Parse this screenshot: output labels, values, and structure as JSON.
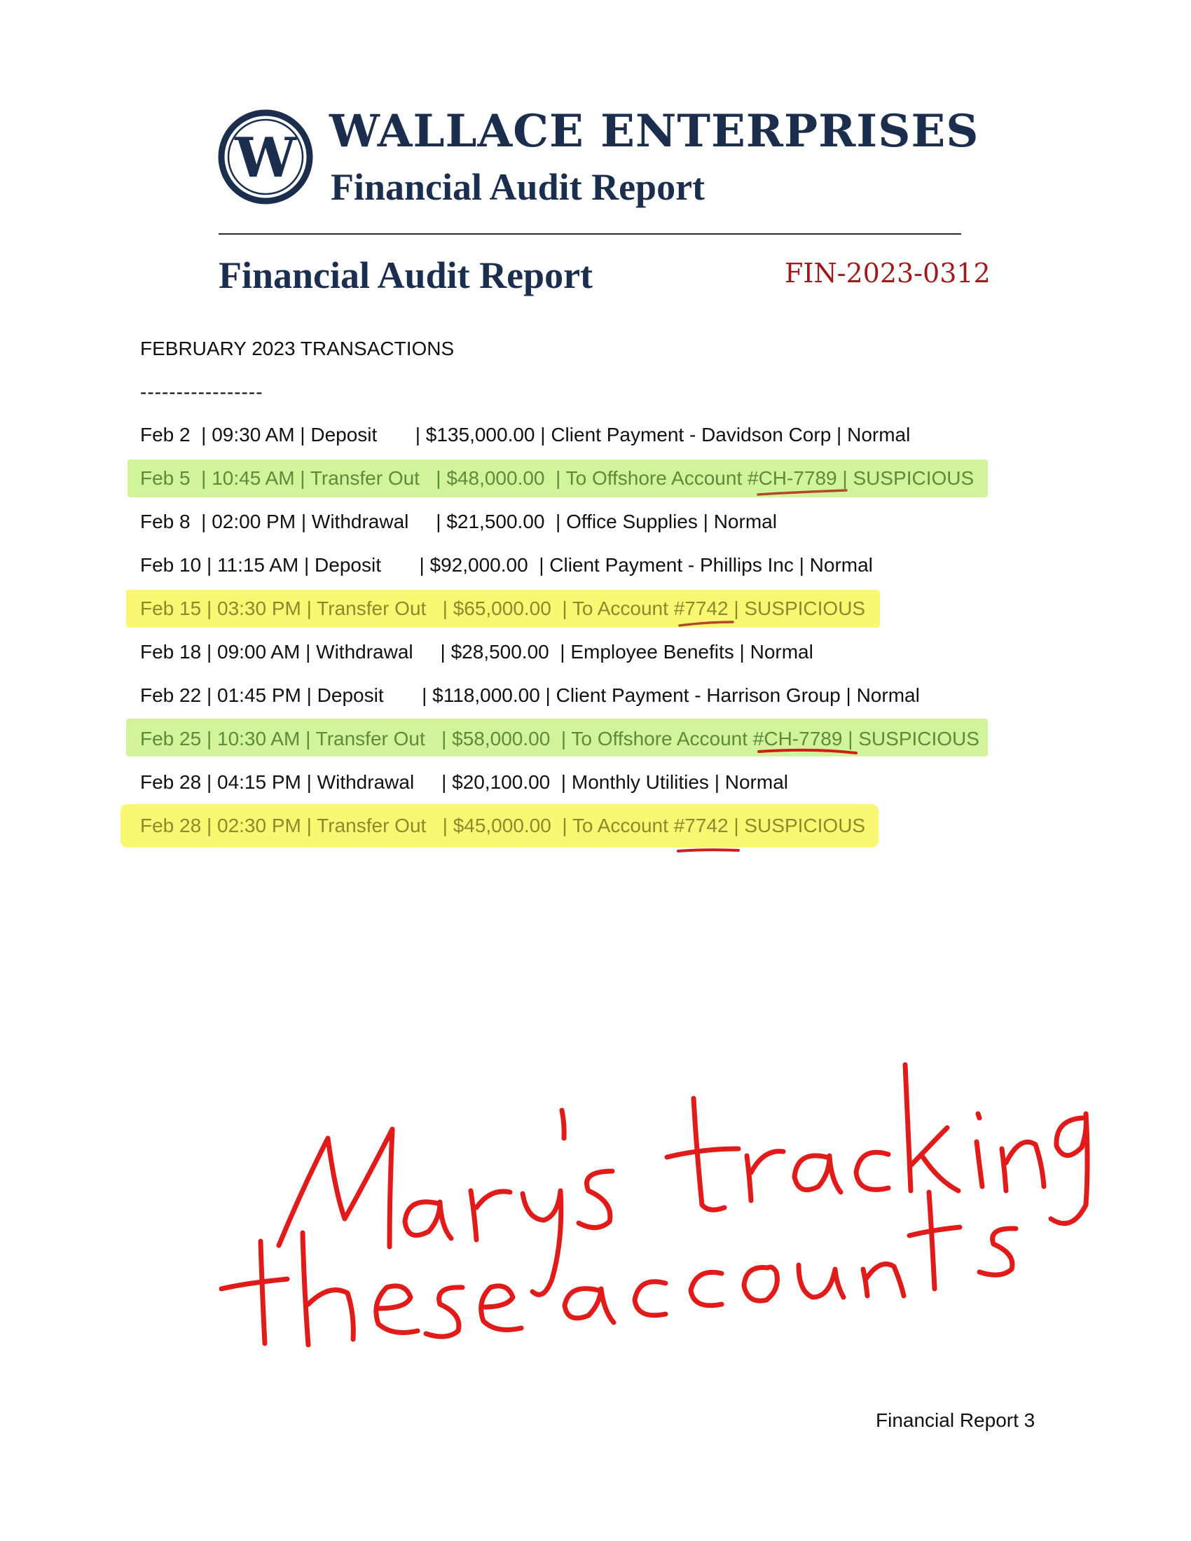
{
  "letterhead": {
    "logo_letter": "W",
    "company_name": "WALLACE ENTERPRISES",
    "subtitle": "Financial Audit Report",
    "brand_color": "#1b2e4e"
  },
  "document": {
    "title": "Financial Audit Report",
    "reference": "FIN-2023-0312",
    "reference_color": "#9e1b1b"
  },
  "section": {
    "heading": "FEBRUARY 2023 TRANSACTIONS",
    "separator": "-----------------"
  },
  "transactions": [
    {
      "text": "Feb 2  | 09:30 AM | Deposit       | $135,000.00 | Client Payment - Davidson Corp | Normal",
      "highlight": "none"
    },
    {
      "text": "Feb 5  | 10:45 AM | Transfer Out   | $48,000.00  | To Offshore Account #CH-7789 | SUSPICIOUS",
      "highlight": "green"
    },
    {
      "text": "Feb 8  | 02:00 PM | Withdrawal     | $21,500.00  | Office Supplies | Normal",
      "highlight": "none"
    },
    {
      "text": "Feb 10 | 11:15 AM | Deposit       | $92,000.00  | Client Payment - Phillips Inc | Normal",
      "highlight": "none"
    },
    {
      "text": "Feb 15 | 03:30 PM | Transfer Out   | $65,000.00  | To Account #7742 | SUSPICIOUS",
      "highlight": "yellow"
    },
    {
      "text": "Feb 18 | 09:00 AM | Withdrawal     | $28,500.00  | Employee Benefits | Normal",
      "highlight": "none"
    },
    {
      "text": "Feb 22 | 01:45 PM | Deposit       | $118,000.00 | Client Payment - Harrison Group | Normal",
      "highlight": "none"
    },
    {
      "text": "Feb 25 | 10:30 AM | Transfer Out   | $58,000.00  | To Offshore Account #CH-7789 | SUSPICIOUS",
      "highlight": "green"
    },
    {
      "text": "Feb 28 | 04:15 PM | Withdrawal     | $20,100.00  | Monthly Utilities | Normal",
      "highlight": "none"
    },
    {
      "text": "Feb 28 | 02:30 PM | Transfer Out   | $45,000.00  | To Account #7742 | SUSPICIOUS",
      "highlight": "yellow"
    }
  ],
  "highlight_colors": {
    "green": "#c9f28a",
    "yellow": "#f9f75a"
  },
  "handwritten_note": {
    "text": "Mary's tracking these accounts",
    "color": "#e11a1a"
  },
  "footer": {
    "page_label": "Financial Report 3"
  }
}
